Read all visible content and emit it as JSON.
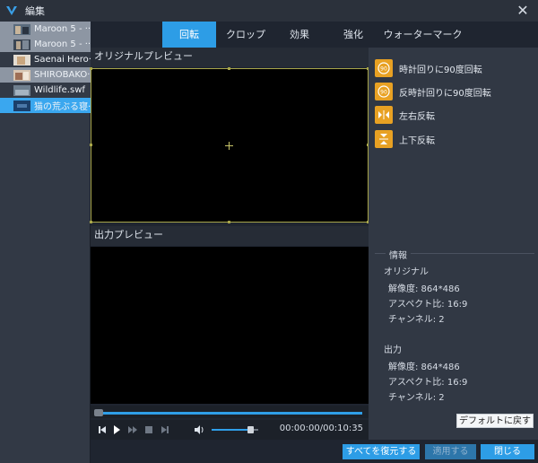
{
  "window": {
    "title": "編集"
  },
  "files": [
    {
      "name": "Maroon 5 - ···",
      "state": "alt"
    },
    {
      "name": "Maroon 5 - ···",
      "state": "alt"
    },
    {
      "name": "Saenai Hero···",
      "state": "plain"
    },
    {
      "name": "SHIROBAKO···",
      "state": "alt"
    },
    {
      "name": "Wildlife.swf",
      "state": "plain"
    },
    {
      "name": "猫の荒ぶる寝···",
      "state": "selected"
    }
  ],
  "tabs": [
    {
      "label": "回転",
      "active": true
    },
    {
      "label": "クロップ",
      "active": false
    },
    {
      "label": "効果",
      "active": false
    },
    {
      "label": "強化",
      "active": false
    },
    {
      "label": "ウォーターマーク",
      "active": false
    }
  ],
  "preview": {
    "original_label": "オリジナルプレビュー",
    "output_label": "出力プレビュー"
  },
  "player": {
    "time": "00:00:00/00:10:35",
    "volume_fraction": 0.85,
    "progress_fraction": 0.0
  },
  "rotation": {
    "cw_label": "時計回りに90度回転",
    "ccw_label": "反時計回りに90度回転",
    "hflip_label": "左右反転",
    "vflip_label": "上下反転",
    "cw_badge": "90",
    "ccw_badge": "90"
  },
  "info": {
    "title": "情報",
    "original_heading": "オリジナル",
    "original_resolution": "解像度: 864*486",
    "original_aspect": "アスペクト比: 16:9",
    "original_channels": "チャンネル: 2",
    "output_heading": "出力",
    "output_resolution": "解像度: 864*486",
    "output_aspect": "アスペクト比: 16:9",
    "output_channels": "チャンネル: 2"
  },
  "buttons": {
    "default": "デフォルトに戻す",
    "restore_all": "すべてを復元する",
    "apply": "適用する",
    "close": "閉じる"
  },
  "colors": {
    "accent": "#2d9de6",
    "rotate_icon": "#e8a123",
    "crop_frame": "#a8a64a"
  }
}
